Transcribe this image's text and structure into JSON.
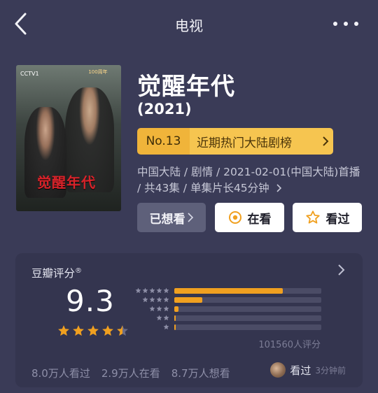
{
  "header": {
    "title": "电视"
  },
  "poster": {
    "title": "觉醒年代",
    "logo_text": "CCTV1",
    "banner_text": "100周年"
  },
  "show": {
    "title": "觉醒年代",
    "year": "(2021)",
    "rank": {
      "number": "No.13",
      "label": "近期热门大陆剧榜"
    },
    "meta": "中国大陆 / 剧情 / 2021-02-01(中国大陆)首播 / 共43集 / 单集片长45分钟"
  },
  "actions": {
    "wanted_label": "已想看",
    "watching_label": "在看",
    "watched_label": "看过"
  },
  "rating": {
    "title": "豆瓣评分",
    "title_mark": "®",
    "score": "9.3",
    "score_stars": 4.5,
    "distribution": [
      {
        "stars": 5,
        "fraction": 0.74
      },
      {
        "stars": 4,
        "fraction": 0.19
      },
      {
        "stars": 3,
        "fraction": 0.03
      },
      {
        "stars": 2,
        "fraction": 0.005
      },
      {
        "stars": 1,
        "fraction": 0.005
      }
    ],
    "count": "101560人评分",
    "stats": [
      "8.0万人看过",
      "2.9万人在看",
      "8.7万人想看"
    ],
    "friend_action": "看过",
    "friend_time": "3分钟前"
  },
  "colors": {
    "background": "#3a3b57",
    "panel": "#34354f",
    "accent": "#f0a020",
    "rank_badge": "#f6c550"
  },
  "icons": [
    "back-arrow-icon",
    "more-dots-icon",
    "target-icon",
    "star-outline-icon",
    "chevron-right-icon",
    "star-icon"
  ]
}
